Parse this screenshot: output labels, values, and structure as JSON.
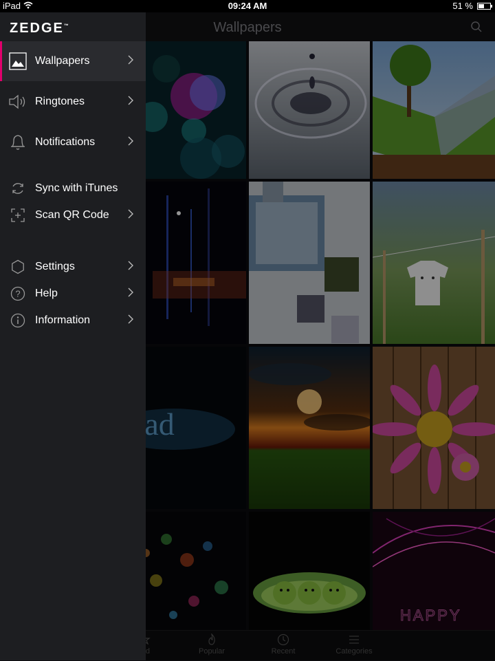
{
  "status_bar": {
    "device": "iPad",
    "time": "09:24 AM",
    "battery": "51 %",
    "battery_level": 0.51
  },
  "header": {
    "title": "Wallpapers"
  },
  "drawer": {
    "logo": "ZEDGE",
    "logo_mark": "™",
    "items": [
      {
        "label": "Wallpapers",
        "icon": "image-icon",
        "chevron": true,
        "active": true
      },
      {
        "label": "Ringtones",
        "icon": "speaker-icon",
        "chevron": true
      },
      {
        "label": "Notifications",
        "icon": "bell-icon",
        "chevron": true
      },
      {
        "label": "Sync with iTunes",
        "icon": "sync-icon",
        "chevron": false
      },
      {
        "label": "Scan QR Code",
        "icon": "qr-scan-icon",
        "chevron": true
      },
      {
        "label": "Settings",
        "icon": "gear-icon",
        "chevron": true
      },
      {
        "label": "Help",
        "icon": "help-icon",
        "chevron": true
      },
      {
        "label": "Information",
        "icon": "info-icon",
        "chevron": true
      }
    ]
  },
  "tabs": [
    {
      "label": "red",
      "icon": "featured-icon"
    },
    {
      "label": "Popular",
      "icon": "flame-icon"
    },
    {
      "label": "Recent",
      "icon": "clock-icon"
    },
    {
      "label": "Categories",
      "icon": "list-icon"
    }
  ],
  "wallpapers": [
    {
      "subject": "bokeh lights"
    },
    {
      "subject": "water drop"
    },
    {
      "subject": "tree on open book"
    },
    {
      "subject": "light streaks"
    },
    {
      "subject": "abstract squares"
    },
    {
      "subject": "t-shirt on clothesline"
    },
    {
      "subject": "iPad water text",
      "text": "iPad"
    },
    {
      "subject": "sunset over grass"
    },
    {
      "subject": "pink flower heart on wood"
    },
    {
      "subject": "colorful bokeh"
    },
    {
      "subject": "peas in a pod"
    },
    {
      "subject": "happy neon",
      "text": "HAPPY"
    }
  ],
  "colors": {
    "accent": "#e0006c",
    "drawer_bg": "#1d1e21",
    "active_bg": "#2a2b2f"
  }
}
